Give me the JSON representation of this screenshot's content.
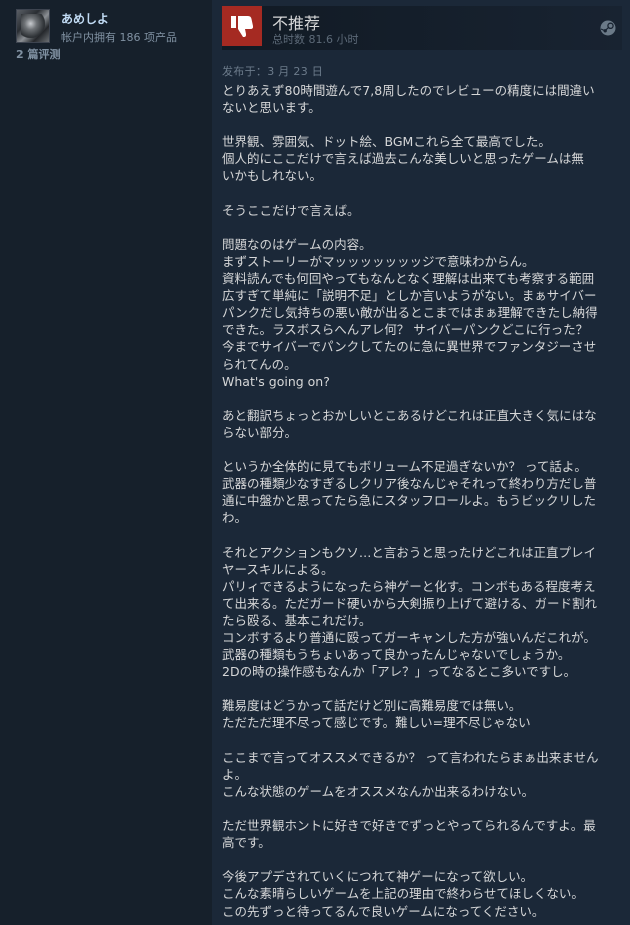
{
  "reviewer": {
    "name": "あめしよ",
    "owned": "帐户内拥有 186 项产品",
    "reviews": "2 篇评测"
  },
  "verdict": {
    "title": "不推荐",
    "hours": "总时数 81.6 小时",
    "thumb_icon": "thumbs-down-icon",
    "platform_icon": "steam-icon",
    "thumb_bg": "#a52a22"
  },
  "posted": "发布于：3 月 23 日",
  "review": {
    "paragraphs": [
      [
        "とりあえず80時間遊んで7,8周したのでレビューの精度には間違い",
        "ないと思います。"
      ],
      [
        "世界観、雰囲気、ドット絵、BGMこれら全て最高でした。",
        "個人的にここだけで言えば過去こんな美しいと思ったゲームは無",
        "いかもしれない。"
      ],
      [
        "そうここだけで言えば。"
      ],
      [
        "問題なのはゲームの内容。",
        "まずストーリーがマッッッッッッッジで意味わからん。",
        "資料読んでも何回やってもなんとなく理解は出来ても考察する範囲",
        "広すぎて単純に「説明不足」としか言いようがない。まぁサイバー",
        "パンクだし気持ちの悪い敵が出るとこまではまぁ理解できたし納得",
        "できた。ラスボスらへんアレ何？ サイバーパンクどこに行った？",
        "今までサイバーでパンクしてたのに急に異世界でファンタジーさせ",
        "られてんの。",
        "What's going on?"
      ],
      [
        "あと翻訳ちょっとおかしいとこあるけどこれは正直大きく気にはな",
        "らない部分。"
      ],
      [
        "というか全体的に見てもボリューム不足過ぎないか？ って話よ。",
        "武器の種類少なすぎるしクリア後なんじゃそれって終わり方だし普",
        "通に中盤かと思ってたら急にスタッフロールよ。もうビックリした",
        "わ。"
      ],
      [
        "それとアクションもクソ…と言おうと思ったけどこれは正直プレイ",
        "ヤースキルによる。",
        "パリィできるようになったら神ゲーと化す。コンボもある程度考え",
        "て出来る。ただガード硬いから大剣振り上げて避ける、ガード割れ",
        "たら殴る、基本これだけ。",
        "コンボするより普通に殴ってガーキャンした方が強いんだこれが。",
        "武器の種類もうちょいあって良かったんじゃないでしょうか。",
        "2Dの時の操作感もなんか「アレ？」ってなるとこ多いですし。"
      ],
      [
        "難易度はどうかって話だけど別に高難易度では無い。",
        "ただただ理不尽って感じです。難しい=理不尽じゃない"
      ],
      [
        "ここまで言ってオススメできるか？ って言われたらまぁ出来ません",
        "よ。",
        "こんな状態のゲームをオススメなんか出来るわけない。"
      ],
      [
        "ただ世界観ホントに好きで好きでずっとやってられるんですよ。最",
        "高です。"
      ],
      [
        "今後アプデされていくにつれて神ゲーになって欲しい。",
        "こんな素晴らしいゲームを上記の理由で終わらせてほしくない。",
        "この先ずっと待ってるんで良いゲームになってください。"
      ]
    ]
  }
}
